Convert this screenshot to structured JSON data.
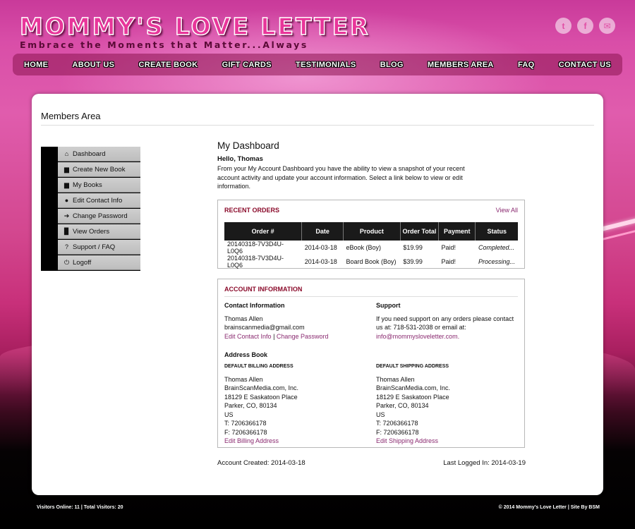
{
  "site": {
    "title": "MOMMY'S LOVE LETTER",
    "tagline": "Embrace the Moments that Matter...Always"
  },
  "social": [
    {
      "icon": "twitter-icon",
      "glyph": "t"
    },
    {
      "icon": "facebook-icon",
      "glyph": "f"
    },
    {
      "icon": "email-icon",
      "glyph": "✉"
    }
  ],
  "nav": [
    "HOME",
    "ABOUT US",
    "CREATE BOOK",
    "GIFT CARDS",
    "TESTIMONIALS",
    "BLOG",
    "MEMBERS AREA",
    "FAQ",
    "CONTACT US"
  ],
  "page": {
    "title": "Members Area"
  },
  "sidebar": [
    {
      "label": "Dashboard",
      "icon": "home-icon",
      "glyph": "⌂"
    },
    {
      "label": "Create New Book",
      "icon": "book-icon",
      "glyph": "▆"
    },
    {
      "label": "My Books",
      "icon": "books-icon",
      "glyph": "▆"
    },
    {
      "label": "Edit Contact Info",
      "icon": "user-icon",
      "glyph": "●"
    },
    {
      "label": "Change Password",
      "icon": "sign-in-icon",
      "glyph": "➔"
    },
    {
      "label": "View Orders",
      "icon": "file-icon",
      "glyph": "▉"
    },
    {
      "label": "Support / FAQ",
      "icon": "question-icon",
      "glyph": "?"
    },
    {
      "label": "Logoff",
      "icon": "power-icon",
      "glyph": "⏻"
    }
  ],
  "dashboard": {
    "title": "My Dashboard",
    "hello": "Hello, Thomas",
    "intro": "From your My Account Dashboard you have the ability to view a snapshot of your recent account activity and update your account information. Select a link below to view or edit information."
  },
  "orders": {
    "heading": "RECENT ORDERS",
    "view_all": "View All",
    "columns": [
      "Order #",
      "Date",
      "Product",
      "Order Total",
      "Payment",
      "Status"
    ],
    "rows": [
      [
        "20140318-7V3D4U-L0Q6",
        "2014-03-18",
        "eBook (Boy)",
        "$19.99",
        "Paid!",
        "Completed..."
      ],
      [
        "20140318-7V3D4U-L0Q6",
        "2014-03-18",
        "Board Book (Boy)",
        "$39.99",
        "Paid!",
        "Processing..."
      ]
    ]
  },
  "account": {
    "heading": "ACCOUNT INFORMATION",
    "contact": {
      "heading": "Contact Information",
      "name": "Thomas Allen",
      "email": "brainscanmedia@gmail.com",
      "edit_link": "Edit Contact Info",
      "separator": "|",
      "password_link": "Change Password"
    },
    "support": {
      "heading": "Support",
      "text": "If you need support on any orders please contact us at: 718-531-2038 or email at:",
      "email": "info@mommysloveletter.com."
    },
    "address_book": "Address Book",
    "billing": {
      "heading": "DEFAULT BILLING ADDRESS",
      "lines": [
        "Thomas Allen",
        "BrainScanMedia.com, Inc.",
        "18129 E Saskatoon Place",
        "Parker, CO, 80134",
        "US",
        "T: 7206366178",
        "F: 7206366178"
      ],
      "edit_link": "Edit Billing Address"
    },
    "shipping": {
      "heading": "DEFAULT SHIPPING ADDRESS",
      "lines": [
        "Thomas Allen",
        "BrainScanMedia.com, Inc.",
        "18129 E Saskatoon Place",
        "Parker, CO, 80134",
        "US",
        "T: 7206366178",
        "F: 7206366178"
      ],
      "edit_link": "Edit Shipping Address"
    }
  },
  "meta": {
    "created": "Account Created: 2014-03-18",
    "last_login": "Last Logged In: 2014-03-19"
  },
  "footer": {
    "left": "Visitors Online: 11 | Total Visitors: 20",
    "right": "© 2014 Mommy's Love Letter | Site By BSM"
  }
}
